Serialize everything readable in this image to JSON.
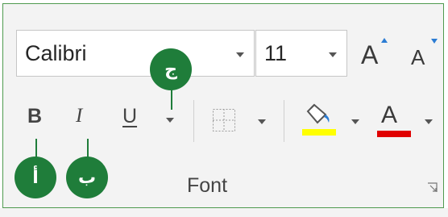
{
  "ribbon": {
    "font_name": {
      "value": "Calibri"
    },
    "font_size": {
      "value": "11"
    },
    "grow_font_label": "A",
    "shrink_font_label": "A",
    "bold_label": "B",
    "italic_label": "I",
    "underline_label": "U",
    "font_color_label": "A",
    "group_label": "Font",
    "colors": {
      "highlight": "#ffff00",
      "font_color": "#e00000",
      "accent_caret": "#2b7cd3",
      "callout": "#1f7d3a"
    },
    "icons": {
      "borders": "borders-icon",
      "fill": "paint-bucket-icon",
      "launcher": "dialog-launcher-icon"
    }
  },
  "callouts": {
    "a": "أ",
    "b": "ب",
    "c": "ج"
  }
}
